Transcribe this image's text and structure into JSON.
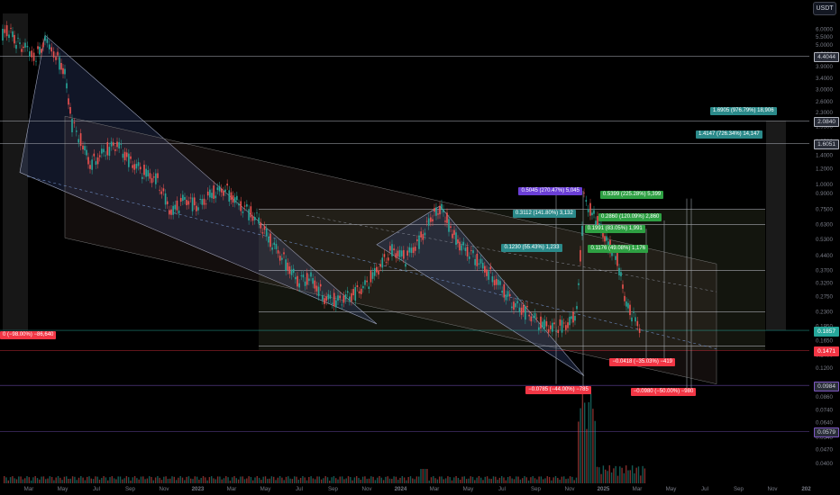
{
  "header": {
    "currency": "USDT"
  },
  "chart_data": {
    "type": "candlestick",
    "x_ticks": [
      "Mar",
      "May",
      "Jul",
      "Sep",
      "Nov",
      "2023",
      "Mar",
      "May",
      "Jul",
      "Sep",
      "Nov",
      "2024",
      "Mar",
      "May",
      "Jul",
      "Sep",
      "Nov",
      "2025",
      "Mar",
      "May",
      "Jul",
      "Sep",
      "Nov",
      "202"
    ],
    "y_ticks": [
      "6.0000",
      "5.5000",
      "5.0000",
      "4.5000",
      "3.9000",
      "3.4000",
      "3.0000",
      "2.6000",
      "2.3000",
      "1.9500",
      "1.6500",
      "1.4000",
      "1.2000",
      "1.0000",
      "0.9000",
      "0.7500",
      "0.6300",
      "0.5300",
      "0.4400",
      "0.3700",
      "0.3200",
      "0.2750",
      "0.2300",
      "0.1950",
      "0.1650",
      "0.1400",
      "0.1200",
      "0.1000",
      "0.0860",
      "0.0740",
      "0.0640",
      "0.0540",
      "0.0470",
      "0.0400"
    ],
    "y_scale": "log",
    "price_tags": [
      {
        "label": "4.4044",
        "color": "#2a2e39",
        "text_color": "#d1d4dc",
        "border": "#b2b5be",
        "value": 4.4044
      },
      {
        "label": "2.0840",
        "color": "#2a2e39",
        "text_color": "#d1d4dc",
        "border": "#b2b5be",
        "value": 2.084
      },
      {
        "label": "1.6051",
        "color": "#2a2e39",
        "text_color": "#d1d4dc",
        "border": "#b2b5be",
        "value": 1.6051
      },
      {
        "label": "0.1857",
        "color": "#26a69a",
        "text_color": "#ffffff",
        "border": "#26a69a",
        "value": 0.1857
      },
      {
        "label": "0.1471",
        "color": "#f23645",
        "text_color": "#ffffff",
        "border": "#f23645",
        "value": 0.1471
      },
      {
        "label": "0.0984",
        "color": "#2a2e39",
        "text_color": "#d1d4dc",
        "border": "#7e57c2",
        "value": 0.0984
      },
      {
        "label": "0.0579",
        "color": "#2a2e39",
        "text_color": "#d1d4dc",
        "border": "#7e57c2",
        "value": 0.0579
      }
    ],
    "annotations": [
      {
        "label": "1.6905 (976.79%) 18,906",
        "style": "teal",
        "value": 2.34,
        "x": 0.885
      },
      {
        "label": "1.4147 (726.34%) 14,147",
        "style": "teal",
        "value": 1.78,
        "x": 0.868
      },
      {
        "label": "0.5045 (270.47%) 5,045",
        "style": "purple",
        "value": 0.93,
        "x": 0.655
      },
      {
        "label": "0.5399 (225.28%) 5,399",
        "style": "up2",
        "value": 0.89,
        "x": 0.752
      },
      {
        "label": "0.3112 (141.80%) 3,132",
        "style": "teal",
        "value": 0.71,
        "x": 0.648
      },
      {
        "label": "0.2860 (120.09%) 2,860",
        "style": "up2",
        "value": 0.685,
        "x": 0.75
      },
      {
        "label": "0.1991 (83.05%) 1,991",
        "style": "up2",
        "value": 0.6,
        "x": 0.732
      },
      {
        "label": "0.1230 (55.43%) 1,233",
        "style": "teal",
        "value": 0.48,
        "x": 0.633
      },
      {
        "label": "0.1176 (49.08%) 1,176",
        "style": "up2",
        "value": 0.475,
        "x": 0.736
      },
      {
        "label": "0 (−98.00%) −86,640",
        "style": "down",
        "value": 0.176,
        "x": 0.03
      },
      {
        "label": "−0.0418 (−35.03%) −419",
        "style": "down",
        "value": 0.128,
        "x": 0.765
      },
      {
        "label": "−0.0785 (−44.00%) −785",
        "style": "down",
        "value": 0.093,
        "x": 0.665
      },
      {
        "label": "−0.0980 (−50.00%) −980",
        "style": "down",
        "value": 0.091,
        "x": 0.79
      }
    ]
  }
}
